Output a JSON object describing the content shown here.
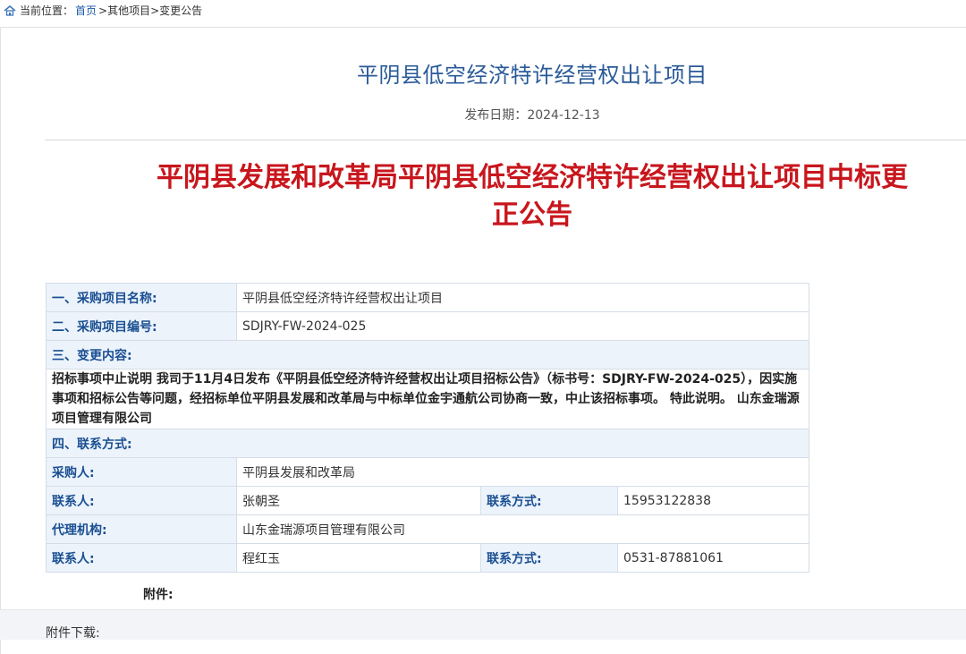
{
  "breadcrumb": {
    "prefix": "当前位置：",
    "home": "首页",
    "rest": " >其他项目>变更公告"
  },
  "header": {
    "title": "平阴县低空经济特许经营权出让项目",
    "date_label": "发布日期：",
    "date": "2024-12-13"
  },
  "headline": "平阴县发展和改革局平阴县低空经济特许经营权出让项目中标更正公告",
  "table": {
    "project_name_label": "一、采购项目名称:",
    "project_name": "平阴县低空经济特许经营权出让项目",
    "project_no_label": "二、采购项目编号:",
    "project_no": "SDJRY-FW-2024-025",
    "change_label": "三、变更内容:",
    "change_text": "招标事项中止说明 我司于11月4日发布《平阴县低空经济特许经营权出让项目招标公告》（标书号：SDJRY-FW-2024-025），因实施事项和招标公告等问题，经招标单位平阴县发展和改革局与中标单位金宇通航公司协商一致，中止该招标事项。 特此说明。 山东金瑞源项目管理有限公司",
    "contact_section_label": "四、联系方式:",
    "purchaser_label": "采购人:",
    "purchaser": "平阴县发展和改革局",
    "contact_label_1": "联系人:",
    "contact_1": "张朝圣",
    "phone_label_1": "联系方式:",
    "phone_1": "15953122838",
    "agency_label": "代理机构:",
    "agency": "山东金瑞源项目管理有限公司",
    "contact_label_2": "联系人:",
    "contact_2": "程红玉",
    "phone_label_2": "联系方式:",
    "phone_2": "0531-87881061"
  },
  "attachments_label": "附件:",
  "download_label": "附件下载:",
  "colors": {
    "title_blue": "#2a5a98",
    "headline_red": "#c8161d",
    "label_bg": "#ecf3fb",
    "label_text": "#1a4f92"
  },
  "icons": {
    "home": "home-icon"
  }
}
